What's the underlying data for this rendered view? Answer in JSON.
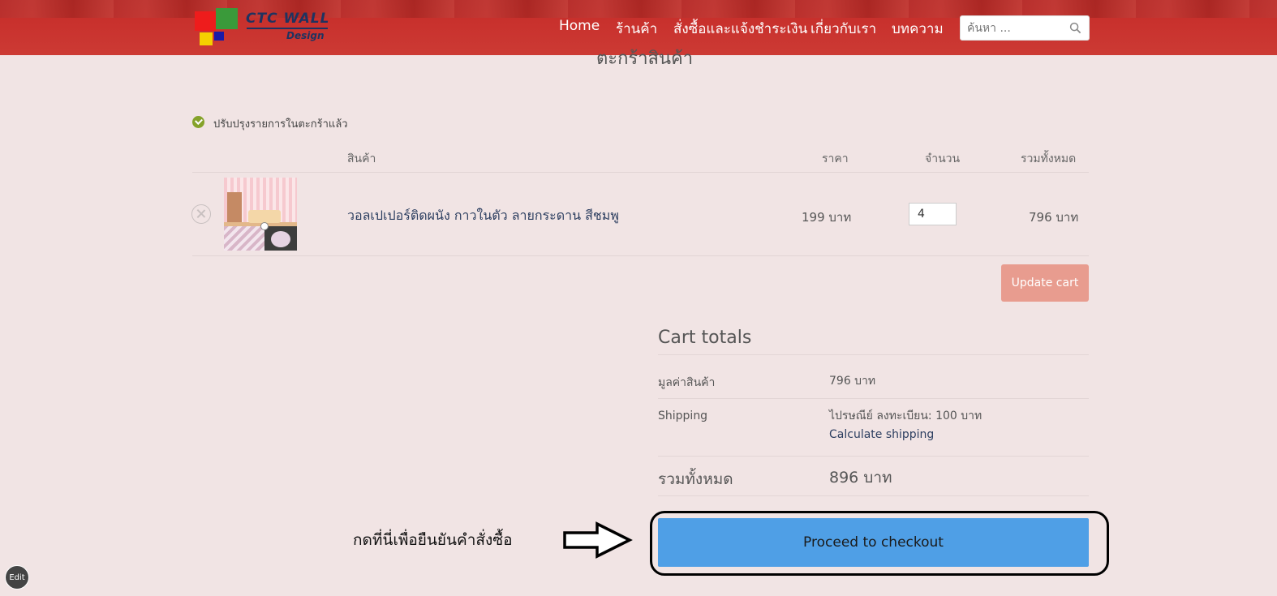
{
  "header": {
    "brand_top": "CTC WALL",
    "brand_bottom": "Design",
    "nav": [
      {
        "label": "Home"
      },
      {
        "label": "ร้านค้า"
      },
      {
        "label": "สั่งซื้อและแจ้งชำระเงิน"
      },
      {
        "label": "เกี่ยวกับเรา"
      },
      {
        "label": "บทความ"
      }
    ],
    "search_placeholder": "ค้นหา ...",
    "search_icon": "search-icon"
  },
  "page": {
    "title": "ตะกร้าสินค้า",
    "notice": "ปรับปรุงรายการในตะกร้าแล้ว"
  },
  "cart": {
    "columns": {
      "product": "สินค้า",
      "price": "ราคา",
      "quantity": "จำนวน",
      "subtotal": "รวมทั้งหมด"
    },
    "items": [
      {
        "name": "วอลเปเปอร์ติดผนัง กาวในตัว ลายกระดาน สีชมพู",
        "price": "199 บาท",
        "quantity": "4",
        "subtotal": "796 บาท"
      }
    ],
    "update_label": "Update cart"
  },
  "totals": {
    "title": "Cart totals",
    "subtotal_label": "มูลค่าสินค้า",
    "subtotal_value": "796 บาท",
    "shipping_label": "Shipping",
    "shipping_value": "ไปรษณีย์ ลงทะเบียน: 100 บาท",
    "calc_shipping": "Calculate shipping",
    "total_label": "รวมทั้งหมด",
    "total_value": "896 บาท",
    "checkout_label": "Proceed to checkout"
  },
  "annotation": {
    "instruction": "กดที่นี่เพื่อยืนยันคำสั่งซื้อ"
  },
  "edit_label": "Edit",
  "colors": {
    "header": "#c8302c",
    "checkout": "#4f9fe6",
    "update": "#e89c8f",
    "background": "#f1e4e4"
  }
}
